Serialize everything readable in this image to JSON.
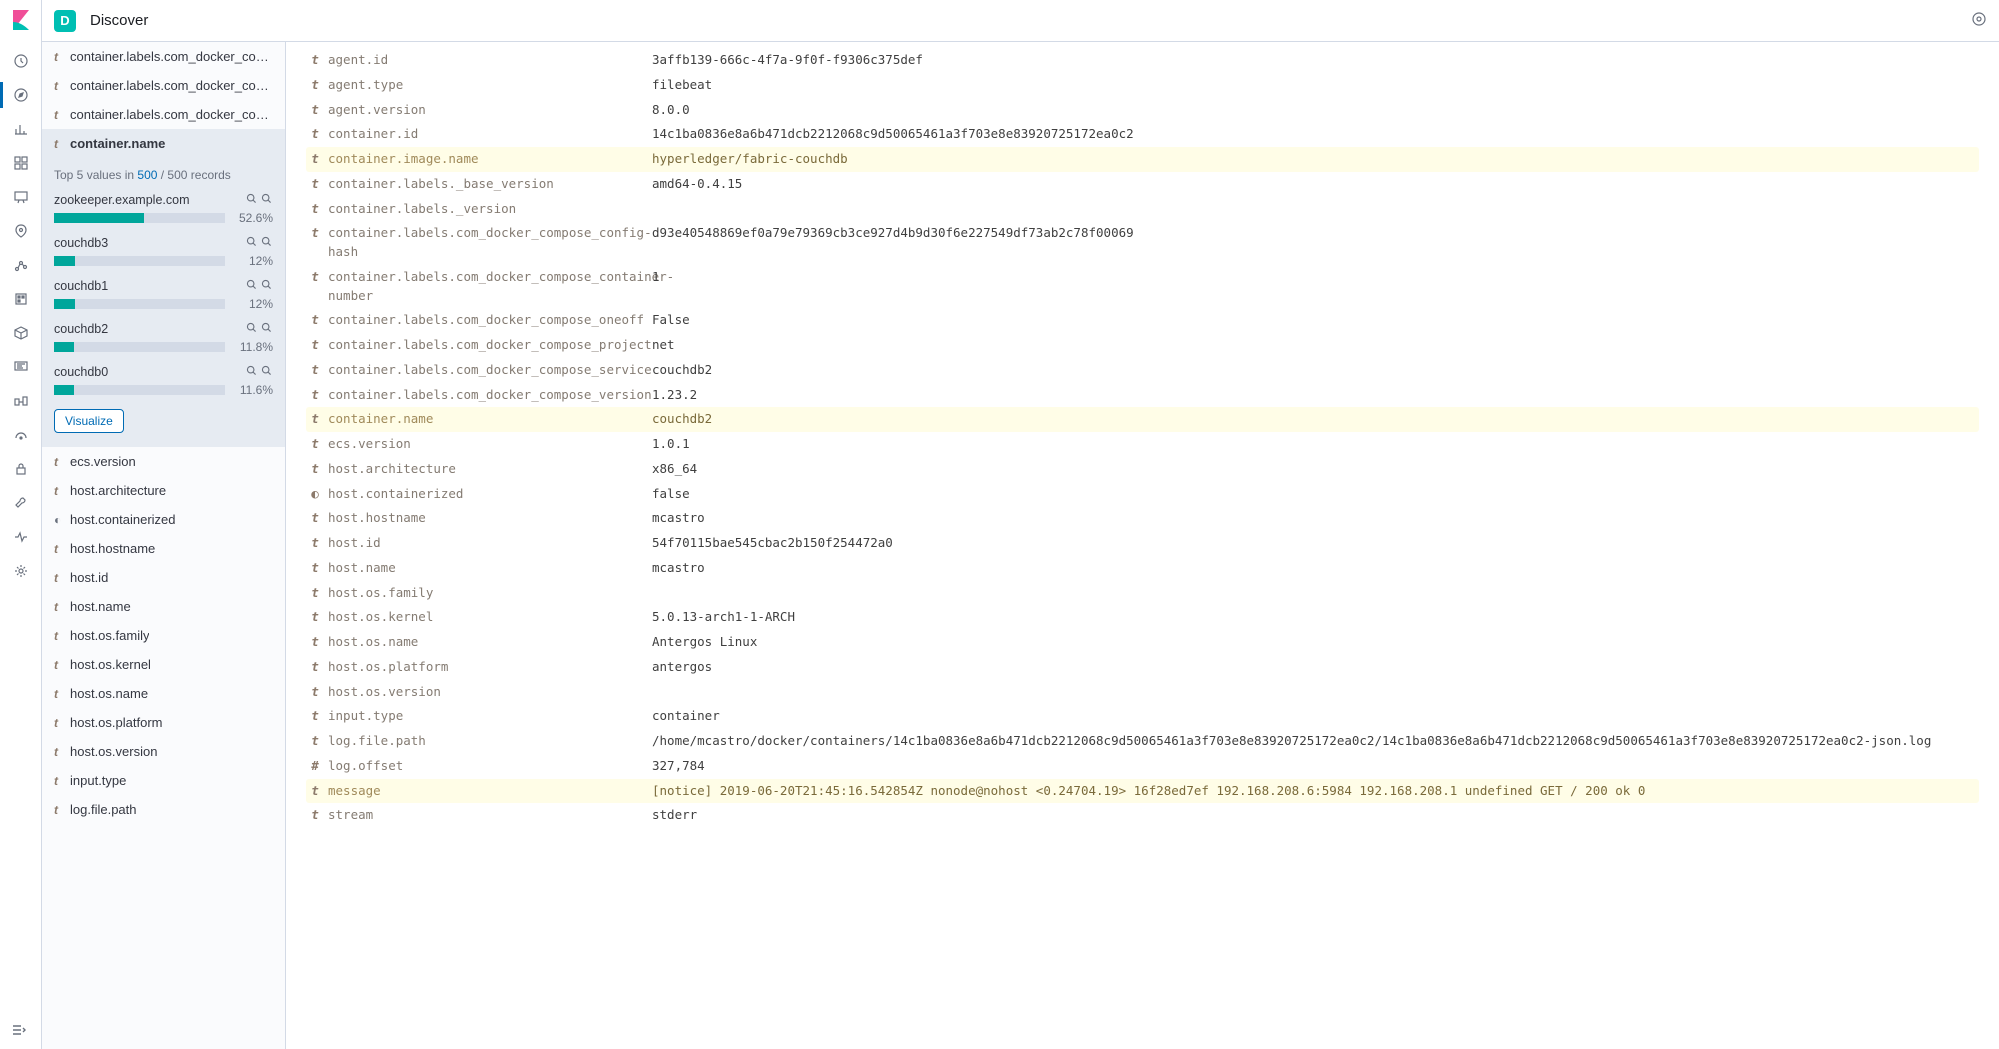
{
  "header": {
    "badge": "D",
    "title": "Discover"
  },
  "fields_sidebar": {
    "before_selected": [
      {
        "type": "t",
        "name": "container.labels.com_docker_comp..."
      },
      {
        "type": "t",
        "name": "container.labels.com_docker_comp..."
      },
      {
        "type": "t",
        "name": "container.labels.com_docker_comp..."
      }
    ],
    "selected": {
      "type": "t",
      "name": "container.name"
    },
    "stats": {
      "summary_prefix": "Top 5 values in ",
      "summary_count": "500",
      "summary_suffix": " / 500 records",
      "items": [
        {
          "label": "zookeeper.example.com",
          "pct": 52.6
        },
        {
          "label": "couchdb3",
          "pct": 12
        },
        {
          "label": "couchdb1",
          "pct": 12
        },
        {
          "label": "couchdb2",
          "pct": 11.8
        },
        {
          "label": "couchdb0",
          "pct": 11.6
        }
      ],
      "visualize_label": "Visualize"
    },
    "after_selected": [
      {
        "type": "t",
        "name": "ecs.version"
      },
      {
        "type": "t",
        "name": "host.architecture"
      },
      {
        "type": "bool",
        "name": "host.containerized"
      },
      {
        "type": "t",
        "name": "host.hostname"
      },
      {
        "type": "t",
        "name": "host.id"
      },
      {
        "type": "t",
        "name": "host.name"
      },
      {
        "type": "t",
        "name": "host.os.family"
      },
      {
        "type": "t",
        "name": "host.os.kernel"
      },
      {
        "type": "t",
        "name": "host.os.name"
      },
      {
        "type": "t",
        "name": "host.os.platform"
      },
      {
        "type": "t",
        "name": "host.os.version"
      },
      {
        "type": "t",
        "name": "input.type"
      },
      {
        "type": "t",
        "name": "log.file.path"
      }
    ]
  },
  "doc_rows": [
    {
      "type": "t",
      "key": "agent.id",
      "val": "3affb139-666c-4f7a-9f0f-f9306c375def",
      "hl": false
    },
    {
      "type": "t",
      "key": "agent.type",
      "val": "filebeat",
      "hl": false
    },
    {
      "type": "t",
      "key": "agent.version",
      "val": "8.0.0",
      "hl": false
    },
    {
      "type": "t",
      "key": "container.id",
      "val": "14c1ba0836e8a6b471dcb2212068c9d50065461a3f703e8e83920725172ea0c2",
      "hl": false
    },
    {
      "type": "t",
      "key": "container.image.name",
      "val": "hyperledger/fabric-couchdb",
      "hl": true
    },
    {
      "type": "t",
      "key": "container.labels._base_version",
      "val": "amd64-0.4.15",
      "hl": false
    },
    {
      "type": "t",
      "key": "container.labels._version",
      "val": "",
      "hl": false
    },
    {
      "type": "t",
      "key": "container.labels.com_docker_compose_config-hash",
      "val": "d93e40548869ef0a79e79369cb3ce927d4b9d30f6e227549df73ab2c78f00069",
      "hl": false
    },
    {
      "type": "t",
      "key": "container.labels.com_docker_compose_container-number",
      "val": "1",
      "hl": false
    },
    {
      "type": "t",
      "key": "container.labels.com_docker_compose_oneoff",
      "val": "False",
      "hl": false
    },
    {
      "type": "t",
      "key": "container.labels.com_docker_compose_project",
      "val": "net",
      "hl": false
    },
    {
      "type": "t",
      "key": "container.labels.com_docker_compose_service",
      "val": "couchdb2",
      "hl": false
    },
    {
      "type": "t",
      "key": "container.labels.com_docker_compose_version",
      "val": "1.23.2",
      "hl": false
    },
    {
      "type": "t",
      "key": "container.name",
      "val": "couchdb2",
      "hl": true
    },
    {
      "type": "t",
      "key": "ecs.version",
      "val": "1.0.1",
      "hl": false
    },
    {
      "type": "t",
      "key": "host.architecture",
      "val": "x86_64",
      "hl": false
    },
    {
      "type": "bool",
      "key": "host.containerized",
      "val": "false",
      "hl": false
    },
    {
      "type": "t",
      "key": "host.hostname",
      "val": "mcastro",
      "hl": false
    },
    {
      "type": "t",
      "key": "host.id",
      "val": "54f70115bae545cbac2b150f254472a0",
      "hl": false
    },
    {
      "type": "t",
      "key": "host.name",
      "val": "mcastro",
      "hl": false
    },
    {
      "type": "t",
      "key": "host.os.family",
      "val": "",
      "hl": false
    },
    {
      "type": "t",
      "key": "host.os.kernel",
      "val": "5.0.13-arch1-1-ARCH",
      "hl": false
    },
    {
      "type": "t",
      "key": "host.os.name",
      "val": "Antergos Linux",
      "hl": false
    },
    {
      "type": "t",
      "key": "host.os.platform",
      "val": "antergos",
      "hl": false
    },
    {
      "type": "t",
      "key": "host.os.version",
      "val": "",
      "hl": false
    },
    {
      "type": "t",
      "key": "input.type",
      "val": "container",
      "hl": false
    },
    {
      "type": "t",
      "key": "log.file.path",
      "val": "/home/mcastro/docker/containers/14c1ba0836e8a6b471dcb2212068c9d50065461a3f703e8e83920725172ea0c2/14c1ba0836e8a6b471dcb2212068c9d50065461a3f703e8e83920725172ea0c2-json.log",
      "hl": false
    },
    {
      "type": "#",
      "key": "log.offset",
      "val": "327,784",
      "hl": false
    },
    {
      "type": "t",
      "key": "message",
      "val": "[notice] 2019-06-20T21:45:16.542854Z nonode@nohost <0.24704.19> 16f28ed7ef 192.168.208.6:5984 192.168.208.1 undefined GET / 200 ok 0",
      "hl": true
    },
    {
      "type": "t",
      "key": "stream",
      "val": "stderr",
      "hl": false
    }
  ],
  "icons": {
    "type_bool_glyph": "◐"
  }
}
